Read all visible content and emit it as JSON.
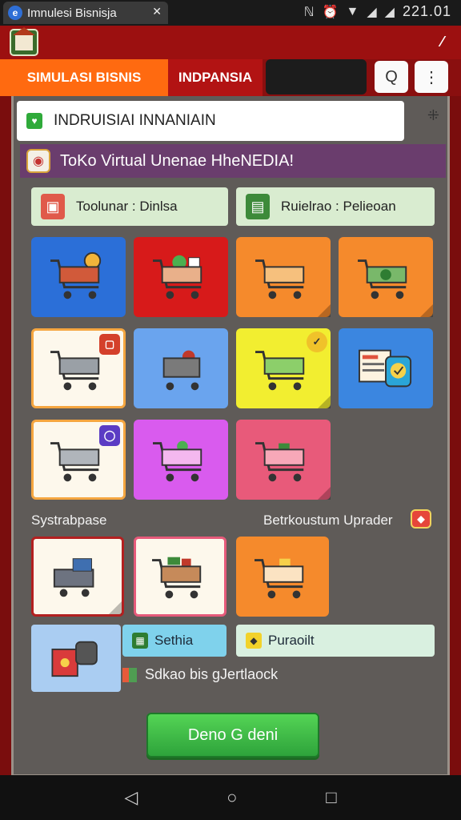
{
  "status_bar": {
    "tab_title": "Imnulesi Bisnisja",
    "tab_logo_glyph": "e",
    "tab_close_glyph": "✕",
    "signal_glyphs": [
      "ℕ",
      "⏰",
      "▼",
      "◢",
      "◢"
    ],
    "clock": "221.01"
  },
  "app_bar": {
    "menu_glyph": "⁄"
  },
  "top_tabs": {
    "tab_active": "SIMULASI BISNIS",
    "tab_second": "INDPANSIA",
    "search_glyph": "Q",
    "more_glyph": "⋮"
  },
  "search": {
    "value": "INDRUISIAI INNANIAIN",
    "clear_glyph": "⁜"
  },
  "store": {
    "title": "ToKo Virtual Unenae HheNEDIA!"
  },
  "categories": [
    {
      "label": "Toolunar : Dinlsa"
    },
    {
      "label": "Ruielrao : Pelieoan"
    }
  ],
  "tile_colors": {
    "blue": "#2b6fd8",
    "red": "#d71a1a",
    "orange": "#f58a2c",
    "cream": "#fdf8ec",
    "lightblue": "#6aa4ee",
    "yellow": "#f2ee30",
    "purple": "#d95bee",
    "pink": "#e85a7a",
    "accent": "#ff6a10",
    "brand": "#9c1010"
  },
  "sections": {
    "left_label": "Systrabpase",
    "right_label": "Betrkoustum Uprader"
  },
  "promo": {
    "pill_1": "Sethia",
    "pill_2": "Puraoilt",
    "line": "Sdkao bis gJertlaock"
  },
  "cta": {
    "label": "Deno G deni"
  },
  "nav": {
    "back": "◁",
    "home": "○",
    "recent": "□"
  }
}
